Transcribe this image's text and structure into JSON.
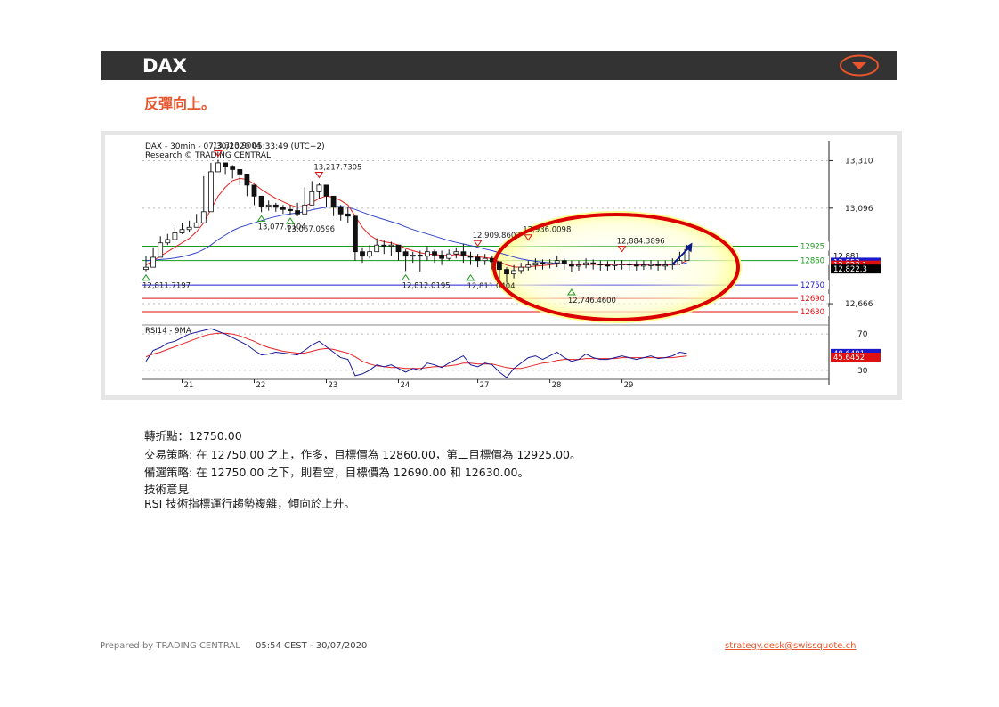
{
  "header": {
    "title": "DAX",
    "direction_icon": "down-triangle-in-ellipse-icon",
    "subtitle": "反彈向上。"
  },
  "colors": {
    "header_bg": "#333333",
    "accent": "#e8542c",
    "resistance": "#1a9a1a",
    "pivot": "#1a1acc",
    "support": "#dd1111",
    "ma_fast": "#e82222",
    "ma_slow": "#3344cc",
    "highlight": "#dd0000"
  },
  "chart_data": {
    "type": "candlestick",
    "chart_title": "DAX - 30min - 07/30/2020 05:33:49 (UTC+2)",
    "chart_source": "Research © TRADING CENTRAL",
    "ylim": [
      12570,
      13400
    ],
    "yticks": [
      12666,
      13096,
      13310
    ],
    "ytick_labels": [
      "12,666",
      "13,096",
      "13,310"
    ],
    "x_labels": [
      {
        "label": "21",
        "index": 5
      },
      {
        "label": "22",
        "index": 15
      },
      {
        "label": "23",
        "index": 25
      },
      {
        "label": "24",
        "index": 35
      },
      {
        "label": "27",
        "index": 46
      },
      {
        "label": "28",
        "index": 56
      },
      {
        "label": "29",
        "index": 66
      }
    ],
    "n_bars": 76,
    "close": [
      12830,
      12875,
      12940,
      12955,
      12985,
      13000,
      13010,
      13030,
      13080,
      13260,
      13300,
      13285,
      13270,
      13250,
      13200,
      13150,
      13105,
      13110,
      13100,
      13090,
      13085,
      13070,
      13110,
      13170,
      13200,
      13150,
      13100,
      13070,
      13060,
      12900,
      12880,
      12900,
      12930,
      12925,
      12930,
      12900,
      12880,
      12885,
      12880,
      12900,
      12885,
      12870,
      12890,
      12900,
      12880,
      12875,
      12860,
      12870,
      12855,
      12820,
      12800,
      12815,
      12830,
      12840,
      12850,
      12845,
      12850,
      12860,
      12845,
      12835,
      12840,
      12850,
      12845,
      12840,
      12838,
      12842,
      12845,
      12840,
      12838,
      12840,
      12842,
      12838,
      12840,
      12845,
      12860,
      12910
    ],
    "high": [
      12880,
      12920,
      12970,
      12980,
      13010,
      13030,
      13040,
      13070,
      13240,
      13300,
      13314,
      13300,
      13290,
      13270,
      13230,
      13180,
      13150,
      13130,
      13120,
      13110,
      13110,
      13120,
      13190,
      13218,
      13210,
      13180,
      13140,
      13110,
      13100,
      12930,
      12920,
      12930,
      12960,
      12950,
      12945,
      12930,
      12910,
      12900,
      12905,
      12925,
      12910,
      12905,
      12910,
      12920,
      12936,
      12900,
      12890,
      12890,
      12880,
      12850,
      12830,
      12840,
      12850,
      12860,
      12870,
      12865,
      12866,
      12880,
      12870,
      12860,
      12860,
      12870,
      12865,
      12860,
      12858,
      12860,
      12862,
      12860,
      12858,
      12860,
      12862,
      12860,
      12860,
      12870,
      12900,
      12930
    ],
    "low": [
      12812,
      12830,
      12900,
      12930,
      12960,
      12980,
      12990,
      13010,
      13060,
      13200,
      13270,
      13250,
      13230,
      13200,
      13150,
      13110,
      13078,
      13085,
      13080,
      13070,
      13068,
      13060,
      13090,
      13140,
      13140,
      13100,
      13060,
      13040,
      13030,
      12860,
      12850,
      12870,
      12900,
      12890,
      12880,
      12860,
      12813,
      12850,
      12811,
      12860,
      12850,
      12840,
      12860,
      12870,
      12850,
      12840,
      12830,
      12840,
      12820,
      12746,
      12760,
      12780,
      12800,
      12815,
      12820,
      12820,
      12825,
      12830,
      12820,
      12810,
      12815,
      12825,
      12820,
      12815,
      12815,
      12818,
      12820,
      12815,
      12815,
      12818,
      12820,
      12815,
      12818,
      12820,
      12840,
      12880
    ],
    "ma_fast": [
      12840,
      12860,
      12880,
      12900,
      12920,
      12940,
      12960,
      12990,
      13030,
      13090,
      13150,
      13190,
      13220,
      13230,
      13225,
      13205,
      13180,
      13160,
      13140,
      13125,
      13110,
      13100,
      13105,
      13120,
      13140,
      13150,
      13145,
      13130,
      13110,
      13060,
      13010,
      12975,
      12955,
      12945,
      12940,
      12930,
      12915,
      12905,
      12895,
      12890,
      12888,
      12884,
      12884,
      12887,
      12885,
      12882,
      12877,
      12874,
      12869,
      12855,
      12840,
      12832,
      12830,
      12832,
      12835,
      12838,
      12841,
      12845,
      12845,
      12843,
      12842,
      12843,
      12843,
      12842,
      12841,
      12841,
      12841,
      12841,
      12840,
      12840,
      12840,
      12840,
      12840,
      12841,
      12845,
      12860
    ],
    "ma_slow": [
      12860,
      12862,
      12865,
      12868,
      12872,
      12878,
      12885,
      12895,
      12910,
      12930,
      12955,
      12975,
      12995,
      13010,
      13020,
      13030,
      13040,
      13050,
      13058,
      13065,
      13070,
      13075,
      13080,
      13088,
      13095,
      13100,
      13103,
      13104,
      13100,
      13090,
      13078,
      13066,
      13055,
      13045,
      13035,
      13025,
      13012,
      13000,
      12990,
      12980,
      12970,
      12960,
      12950,
      12942,
      12935,
      12928,
      12920,
      12912,
      12905,
      12895,
      12885,
      12876,
      12868,
      12862,
      12857,
      12853,
      12850,
      12848,
      12846,
      12844,
      12843,
      12843,
      12843,
      12842,
      12842,
      12842,
      12842,
      12842,
      12842,
      12842,
      12842,
      12842,
      12842,
      12842,
      12844,
      12850
    ],
    "levels": [
      {
        "value": 12925,
        "label": "12925",
        "role": "resistance"
      },
      {
        "value": 12860,
        "label": "12860",
        "role": "resistance"
      },
      {
        "value": 12750,
        "label": "12750",
        "role": "pivot"
      },
      {
        "value": 12690,
        "label": "12690",
        "role": "support"
      },
      {
        "value": 12630,
        "label": "12630",
        "role": "support"
      }
    ],
    "price_tags": [
      {
        "value": 12881,
        "label": "12,881",
        "bg": "#ffffff",
        "fg": "#000000"
      },
      {
        "value": 12853,
        "label": "12,853",
        "bg": "#1a1acc",
        "fg": "#ffffff"
      },
      {
        "value": 12840,
        "label": "12,823.1",
        "bg": "#dd1111",
        "fg": "#ffffff"
      },
      {
        "value": 12822,
        "label": "12,822.3",
        "bg": "#000000",
        "fg": "#ffffff"
      }
    ],
    "annotations": [
      {
        "index": 10,
        "value": 13313.9004,
        "label": "13,313.9004",
        "kind": "high"
      },
      {
        "index": 24,
        "value": 13217.7305,
        "label": "13,217.7305",
        "kind": "high"
      },
      {
        "index": 16,
        "value": 13077.6104,
        "label": "13,077.6104",
        "kind": "low"
      },
      {
        "index": 20,
        "value": 13067.0596,
        "label": "13,067.0596",
        "kind": "low"
      },
      {
        "index": 0,
        "value": 12811.7197,
        "label": "12,811.7197",
        "kind": "low"
      },
      {
        "index": 36,
        "value": 12812.0195,
        "label": "12,812.0195",
        "kind": "low"
      },
      {
        "index": 45,
        "value": 12811.0404,
        "label": "12,811.0404",
        "kind": "low"
      },
      {
        "index": 46,
        "value": 12909.8603,
        "label": "12,909.8603",
        "kind": "high"
      },
      {
        "index": 53,
        "value": 12936.0098,
        "label": "12,936.0098",
        "kind": "high"
      },
      {
        "index": 59,
        "value": 12746.46,
        "label": "12,746.4600",
        "kind": "low"
      },
      {
        "index": 66,
        "value": 12884.3896,
        "label": "12,884.3896",
        "kind": "high"
      }
    ],
    "rsi": {
      "title": "RSI14 - 9MA",
      "ylim": [
        20,
        80
      ],
      "yticks": [
        30,
        70
      ],
      "ytick_labels": [
        "30",
        "70"
      ],
      "values": [
        40,
        52,
        55,
        60,
        62,
        66,
        70,
        72,
        74,
        76,
        73,
        70,
        66,
        62,
        58,
        52,
        47,
        48,
        50,
        49,
        48,
        47,
        52,
        58,
        62,
        56,
        50,
        44,
        42,
        24,
        26,
        30,
        36,
        34,
        36,
        32,
        28,
        32,
        30,
        38,
        36,
        33,
        38,
        42,
        46,
        36,
        34,
        38,
        36,
        28,
        22,
        32,
        38,
        44,
        46,
        42,
        46,
        50,
        44,
        40,
        42,
        48,
        44,
        42,
        42,
        44,
        46,
        44,
        42,
        44,
        46,
        43,
        44,
        46,
        50,
        48.6
      ],
      "ma": [
        45,
        48,
        50,
        53,
        56,
        59,
        62,
        65,
        68,
        70,
        71,
        71,
        70,
        68,
        65,
        62,
        58,
        55,
        53,
        51,
        50,
        49,
        49,
        51,
        53,
        54,
        53,
        51,
        49,
        45,
        40,
        37,
        35,
        34,
        33,
        33,
        32,
        32,
        32,
        33,
        34,
        34,
        35,
        36,
        38,
        38,
        37,
        37,
        37,
        35,
        33,
        32,
        32,
        34,
        36,
        38,
        39,
        41,
        42,
        42,
        42,
        43,
        43,
        43,
        43,
        43,
        44,
        44,
        44,
        44,
        44,
        44,
        44,
        44,
        45,
        46
      ]
    },
    "rsi_tags": [
      {
        "value": 48.6491,
        "label": "48.6491",
        "bg": "#1a1acc",
        "fg": "#ffffff"
      },
      {
        "value": 44.6,
        "label": "45.6452",
        "bg": "#dd1111",
        "fg": "#ffffff"
      }
    ],
    "forecast": {
      "from_index": 73,
      "from_value": 12843,
      "to_index": 75,
      "to_value": 12925
    }
  },
  "notes": {
    "pivot": "轉折點：12750.00",
    "strategy": "交易策略: 在 12750.00 之上，作多，目標價為 12860.00，第二目標價為 12925.00。",
    "alternative": "備選策略: 在 12750.00 之下，則看空，目標價為 12690.00 和 12630.00。",
    "opinion_title": "技術意見",
    "opinion": "RSI 技術指標運行趨勢複雜，傾向於上升。"
  },
  "footer": {
    "prepared": "Prepared by TRADING CENTRAL",
    "time": "05:54 CEST - 30/07/2020",
    "email": "strategy.desk@swissquote.ch"
  }
}
